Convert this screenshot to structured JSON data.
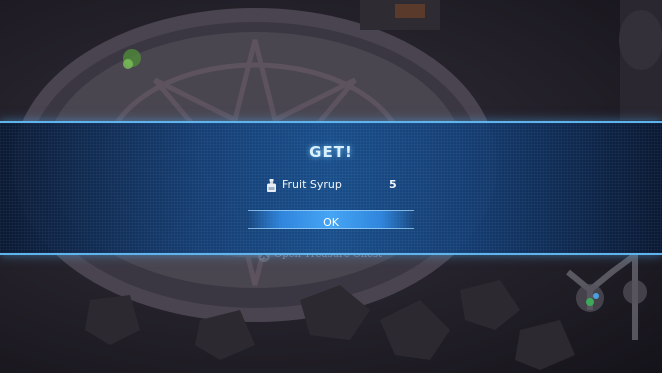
{
  "dialog": {
    "title": "GET!",
    "item": {
      "icon": "bottle-icon",
      "name": "Fruit Syrup",
      "quantity": "5"
    },
    "ok_label": "OK"
  },
  "background_prompt": {
    "button_glyph": "X",
    "text": "Open Treasure Chest"
  },
  "colors": {
    "band_border": "#5fb4ee",
    "band_center": "#164e8c",
    "ok_button": "#46a5f5",
    "title": "#d9f0ff"
  }
}
